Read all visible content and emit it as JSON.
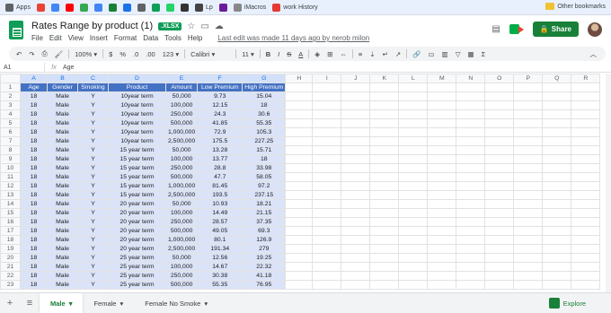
{
  "bookmarks": [
    {
      "label": "Apps",
      "color": "#5f6368"
    },
    {
      "label": "",
      "color": "#ea4335"
    },
    {
      "label": "",
      "color": "#4285f4"
    },
    {
      "label": "",
      "color": "#ff0000"
    },
    {
      "label": "",
      "color": "#34a853"
    },
    {
      "label": "",
      "color": "#4285f4"
    },
    {
      "label": "",
      "color": "#188038"
    },
    {
      "label": "",
      "color": "#1a73e8"
    },
    {
      "label": "",
      "color": "#5f6368"
    },
    {
      "label": "",
      "color": "#0f9d58"
    },
    {
      "label": "",
      "color": "#25d366"
    },
    {
      "label": "",
      "color": "#333333"
    },
    {
      "label": "Lp",
      "color": "#444444"
    },
    {
      "label": "",
      "color": "#6a1b9a"
    },
    {
      "label": "iMacros",
      "color": "#888888"
    },
    {
      "label": "work History",
      "color": "#e53935"
    }
  ],
  "bookmarks_other": "Other bookmarks",
  "doc": {
    "title": "Rates Range by product (1)",
    "badge": ".XLSX"
  },
  "menus": [
    "File",
    "Edit",
    "View",
    "Insert",
    "Format",
    "Data",
    "Tools",
    "Help"
  ],
  "last_edit": "Last edit was made 11 days ago by nerob milon",
  "share_label": "Share",
  "toolbar": {
    "zoom": "100%",
    "currency": "$",
    "percent": "%",
    "dec0": ".0",
    "dec00": ".00",
    "numfmt": "123",
    "font": "Calibri",
    "size": "11"
  },
  "namebox": "A1",
  "formula": "Age",
  "columns": [
    "A",
    "B",
    "C",
    "D",
    "E",
    "F",
    "G",
    "H",
    "I",
    "J",
    "K",
    "L",
    "M",
    "N",
    "O",
    "P",
    "Q",
    "R"
  ],
  "headers": [
    "Age",
    "Gender",
    "Smoking",
    "Product",
    "Amount",
    "Low Premium",
    "High Premium"
  ],
  "rows": [
    [
      "18",
      "Male",
      "Y",
      "10year term",
      "50,000",
      "9.73",
      "15.04"
    ],
    [
      "18",
      "Male",
      "Y",
      "10year term",
      "100,000",
      "12.15",
      "18"
    ],
    [
      "18",
      "Male",
      "Y",
      "10year term",
      "250,000",
      "24.3",
      "30.6"
    ],
    [
      "18",
      "Male",
      "Y",
      "10year term",
      "500,000",
      "41.85",
      "55.35"
    ],
    [
      "18",
      "Male",
      "Y",
      "10year term",
      "1,000,000",
      "72.9",
      "105.3"
    ],
    [
      "18",
      "Male",
      "Y",
      "10year term",
      "2,500,000",
      "175.5",
      "227.25"
    ],
    [
      "18",
      "Male",
      "Y",
      "15 year term",
      "50,000",
      "13.28",
      "15.71"
    ],
    [
      "18",
      "Male",
      "Y",
      "15 year term",
      "100,000",
      "13.77",
      "18"
    ],
    [
      "18",
      "Male",
      "Y",
      "15 year term",
      "250,000",
      "28.8",
      "33.98"
    ],
    [
      "18",
      "Male",
      "Y",
      "15 year term",
      "500,000",
      "47.7",
      "58.05"
    ],
    [
      "18",
      "Male",
      "Y",
      "15 year term",
      "1,000,000",
      "81.45",
      "97.2"
    ],
    [
      "18",
      "Male",
      "Y",
      "15 year term",
      "2,500,000",
      "193.5",
      "237.15"
    ],
    [
      "18",
      "Male",
      "Y",
      "20 year term",
      "50,000",
      "10.93",
      "18.21"
    ],
    [
      "18",
      "Male",
      "Y",
      "20 year term",
      "100,000",
      "14.49",
      "21.15"
    ],
    [
      "18",
      "Male",
      "Y",
      "20 year term",
      "250,000",
      "28.57",
      "37.35"
    ],
    [
      "18",
      "Male",
      "Y",
      "20 year term",
      "500,000",
      "49.05",
      "69.3"
    ],
    [
      "18",
      "Male",
      "Y",
      "20 year term",
      "1,000,000",
      "80.1",
      "126.9"
    ],
    [
      "18",
      "Male",
      "Y",
      "20 year term",
      "2,500,000",
      "191.34",
      "279"
    ],
    [
      "18",
      "Male",
      "Y",
      "25 year term",
      "50,000",
      "12.56",
      "19.25"
    ],
    [
      "18",
      "Male",
      "Y",
      "25 year term",
      "100,000",
      "14.67",
      "22.32"
    ],
    [
      "18",
      "Male",
      "Y",
      "25 year term",
      "250,000",
      "30.38",
      "41.18"
    ],
    [
      "18",
      "Male",
      "Y",
      "25 year term",
      "500,000",
      "55.35",
      "76.95"
    ]
  ],
  "sheets": [
    {
      "label": "Male",
      "active": true
    },
    {
      "label": "Female",
      "active": false
    },
    {
      "label": "Female No Smoke",
      "active": false
    }
  ],
  "explore_label": "Explore"
}
